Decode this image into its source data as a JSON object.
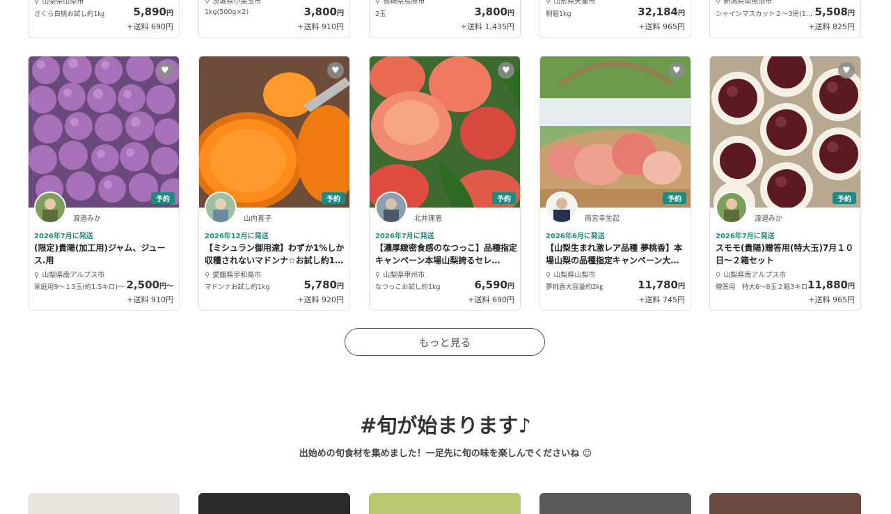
{
  "top_row": [
    {
      "location": "山梨県山梨市",
      "variant": "さくら白桃お試し約1㎏",
      "price": "5,890",
      "yen": "円",
      "shipping": "+送料 690円"
    },
    {
      "location": "茨城県小美玉市",
      "variant": "1kg(500g×2)",
      "price": "3,800",
      "yen": "円",
      "shipping": "+送料 910円"
    },
    {
      "location": "長崎県島原市",
      "variant": "2玉",
      "price": "3,800",
      "yen": "円",
      "shipping": "+送料 1,435円"
    },
    {
      "location": "山形県天童市",
      "variant": "桐箱1kg",
      "price": "32,184",
      "yen": "円",
      "shipping": "+送料 965円"
    },
    {
      "location": "新潟県南魚沼市",
      "variant": "シャインマスカット２～3房(1…",
      "price": "5,508",
      "yen": "円",
      "shipping": "+送料 825円"
    }
  ],
  "products": [
    {
      "producer": "渡邉みか",
      "badge": "予約",
      "ship": "2026年7月に発送",
      "title": "(限定)貴陽(加工用)ジャム、ジュース.用",
      "location": "山梨県南アルプス市",
      "variant": "家庭用9～１3玉(約1.5キロ)～",
      "price": "2,500",
      "yen": "円～",
      "shipping": "+送料 910円",
      "image": "plum-purple",
      "avatar_color": "#7aa05a"
    },
    {
      "producer": "山内直子",
      "badge": "予約",
      "ship": "2026年12月に発送",
      "title": "【ミシュラン御用達】わずか1%しか収穫されないマドンナ☆お試し約1…",
      "location": "愛媛県宇和島市",
      "variant": "マドンナお試し約1kg",
      "price": "5,780",
      "yen": "円",
      "shipping": "+送料 920円",
      "image": "orange-citrus",
      "avatar_color": "#8fb07e"
    },
    {
      "producer": "北井理恵",
      "badge": "予約",
      "ship": "2026年7月に発送",
      "title": "【濃厚緻密食感のなつっこ】品種指定キャンペーン本場山梨誇るセレ…",
      "location": "山梨県甲州市",
      "variant": "なつっこお試し約1kg",
      "price": "6,590",
      "yen": "円",
      "shipping": "+送料 690円",
      "image": "peach-leaves",
      "avatar_color": "#6a7d8e"
    },
    {
      "producer": "雨宮幸生起",
      "badge": "予約",
      "ship": "2026年6月に発送",
      "title": "【山梨生まれ激レア品種 夢桃香】本場山梨の品種指定キャンペーン大…",
      "location": "山梨県山梨市",
      "variant": "夢桃香大容量約2㎏",
      "price": "11,780",
      "yen": "円",
      "shipping": "+送料 745円",
      "image": "peach-basket",
      "avatar_color": "#24344f"
    },
    {
      "producer": "渡邉みか",
      "badge": "予約",
      "ship": "2026年7月に発送",
      "title": "スモモ(貴陽)贈答用(特大玉)7月１０日～２箱セット",
      "location": "山梨県南アルプス市",
      "variant": "贈答用　特大6～8玉２箱3キロ",
      "price": "11,880",
      "yen": "円",
      "shipping": "+送料 965円",
      "image": "plum-dark",
      "avatar_color": "#7aa05a"
    }
  ],
  "more_button": "もっと見る",
  "section": {
    "title": "#旬が始まります♪",
    "subtitle": "出始めの旬食材を集めました！一足先に旬の味を楽しんでくださいね ☺"
  },
  "colors": {
    "accent": "#1e8a82"
  }
}
